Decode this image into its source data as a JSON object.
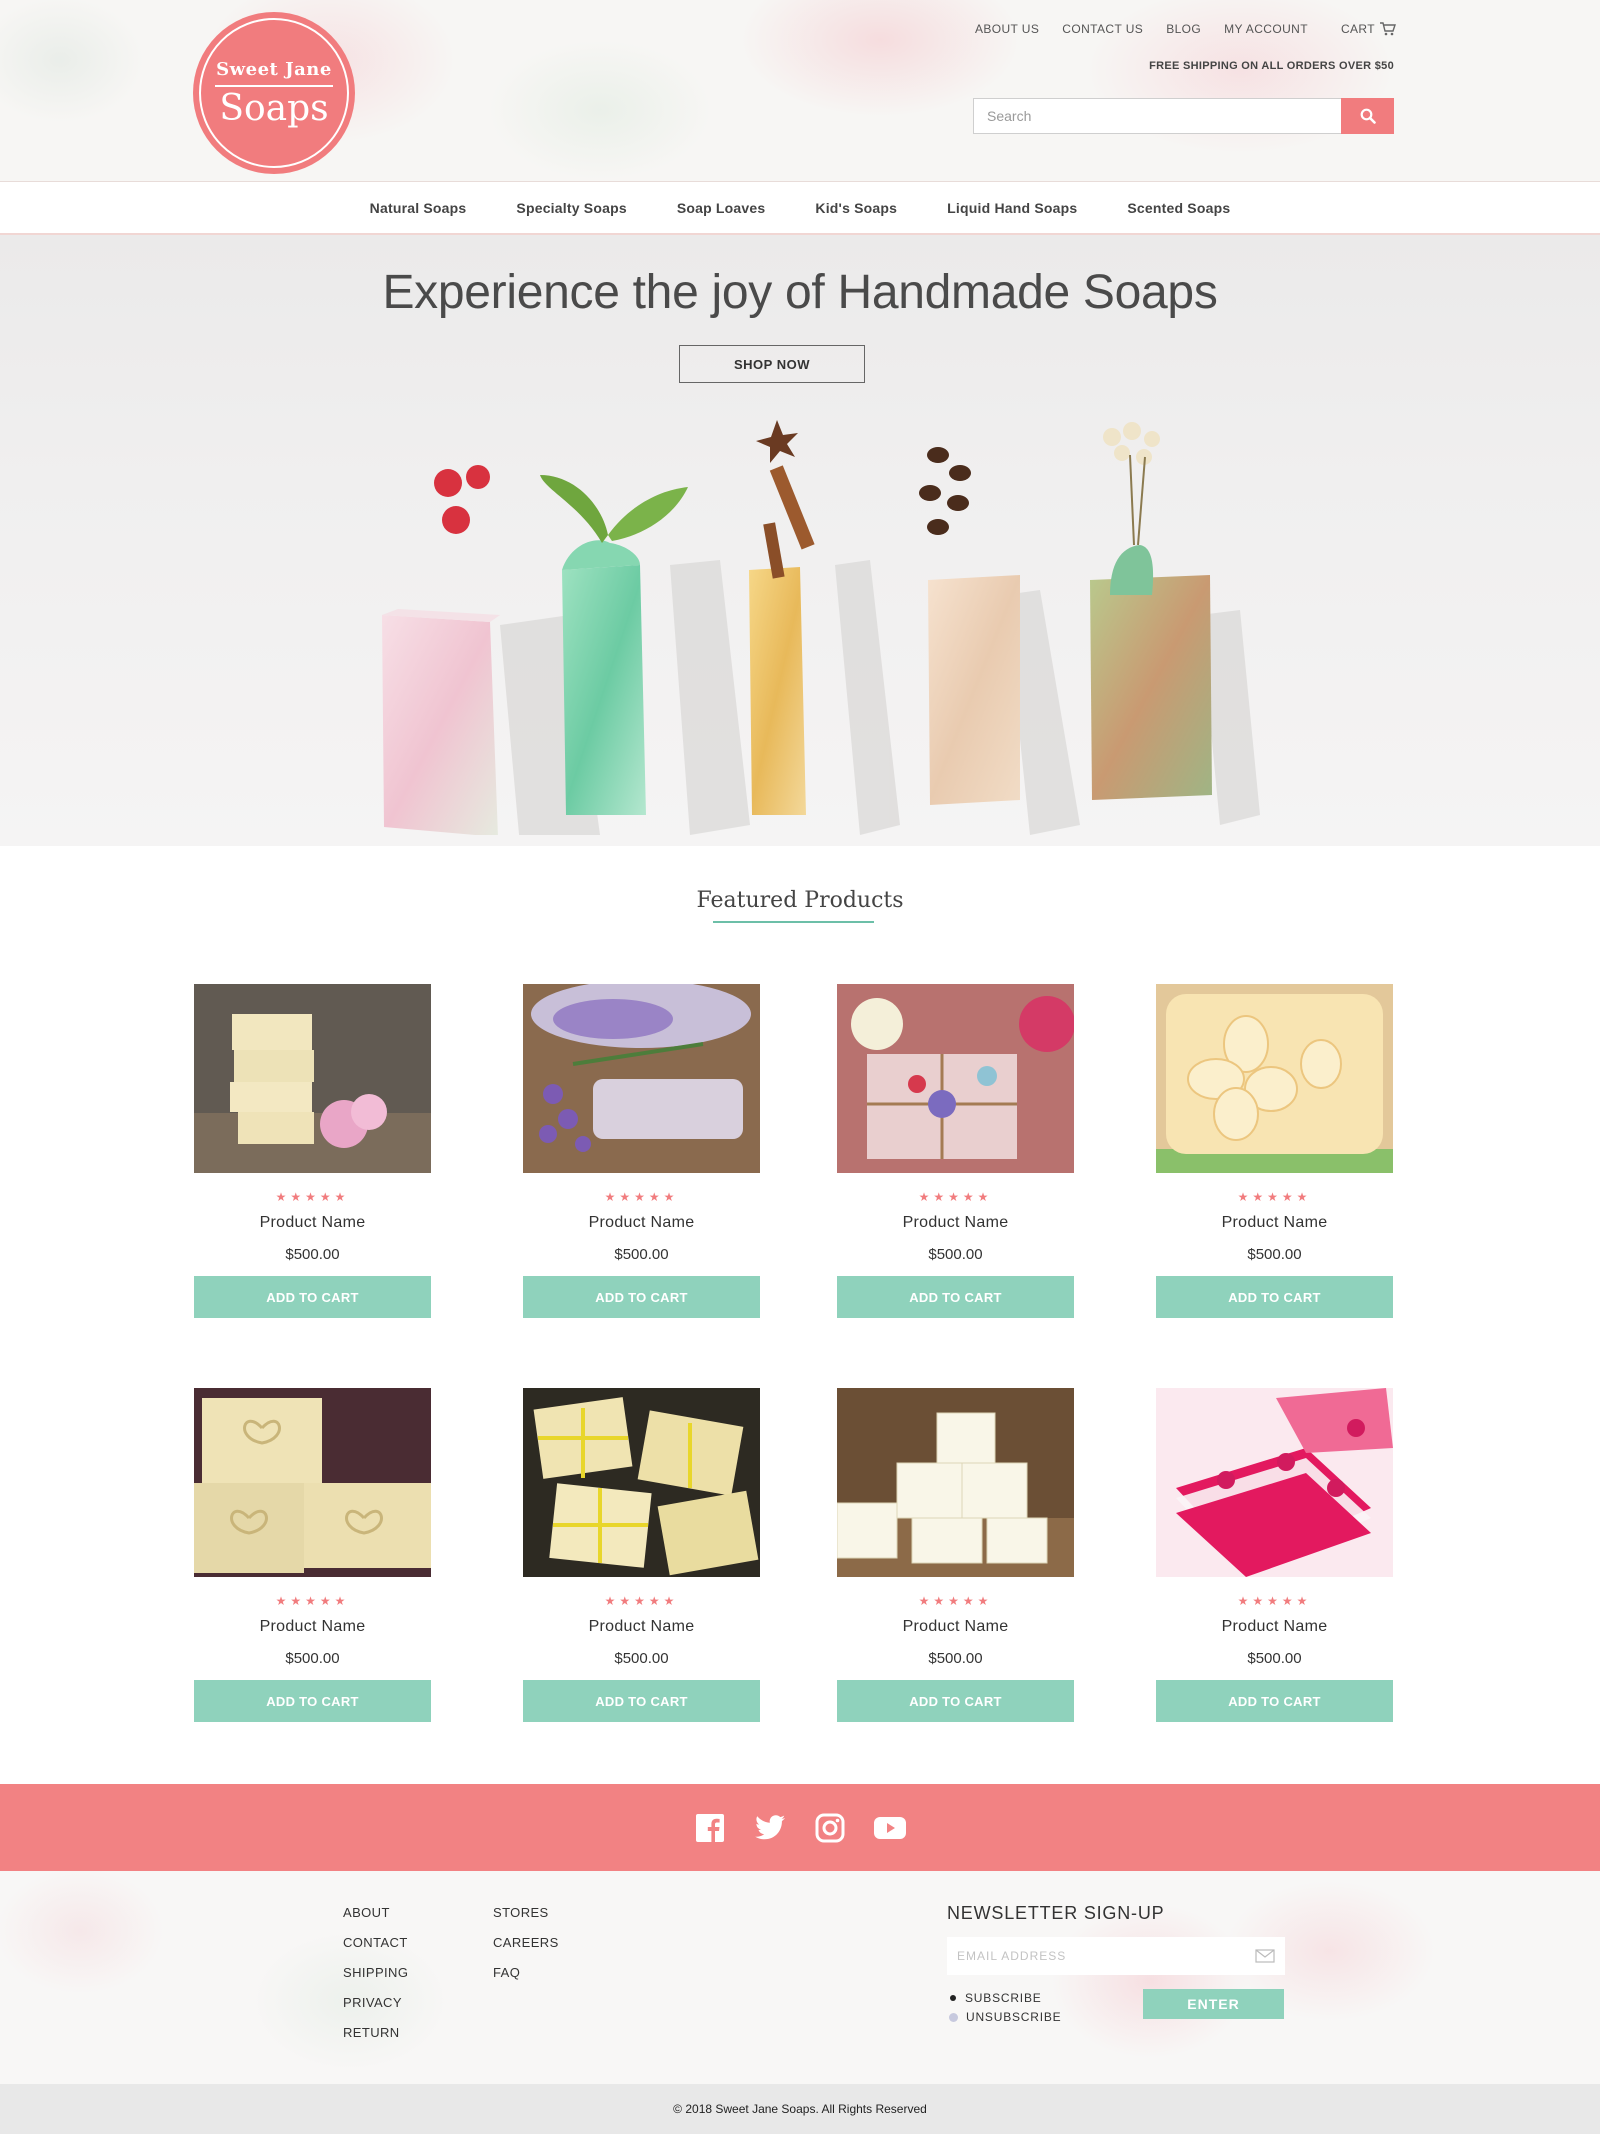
{
  "brand": {
    "logo_top": "Sweet Jane",
    "logo_main": "Soaps",
    "accent": "#f17c7e",
    "mint": "#8fd2bc"
  },
  "topnav": {
    "about": "ABOUT US",
    "contact": "CONTACT US",
    "blog": "BLOG",
    "account": "MY ACCOUNT",
    "cart": "CART"
  },
  "header": {
    "shipping": "FREE SHIPPING ON ALL ORDERS OVER $50"
  },
  "search": {
    "placeholder": "Search",
    "icon": "search-icon"
  },
  "categories": [
    "Natural Soaps",
    "Specialty Soaps",
    "Soap Loaves",
    "Kid's Soaps",
    "Liquid Hand Soaps",
    "Scented Soaps"
  ],
  "hero": {
    "title": "Experience the joy of Handmade Soaps",
    "button": "SHOP NOW"
  },
  "featured": {
    "title": "Featured Products"
  },
  "products": [
    {
      "stars": "★★★★★",
      "rating": 5,
      "name": "Product Name",
      "price": "$500.00",
      "button": "ADD TO CART"
    },
    {
      "stars": "★★★★★",
      "rating": 5,
      "name": "Product Name",
      "price": "$500.00",
      "button": "ADD TO CART"
    },
    {
      "stars": "★★★★★",
      "rating": 5,
      "name": "Product Name",
      "price": "$500.00",
      "button": "ADD TO CART"
    },
    {
      "stars": "★★★★★",
      "rating": 5,
      "name": "Product Name",
      "price": "$500.00",
      "button": "ADD TO CART"
    },
    {
      "stars": "★★★★★",
      "rating": 5,
      "name": "Product Name",
      "price": "$500.00",
      "button": "ADD TO CART"
    },
    {
      "stars": "★★★★★",
      "rating": 5,
      "name": "Product Name",
      "price": "$500.00",
      "button": "ADD TO CART"
    },
    {
      "stars": "★★★★★",
      "rating": 5,
      "name": "Product Name",
      "price": "$500.00",
      "button": "ADD TO CART"
    },
    {
      "stars": "★★★★★",
      "rating": 5,
      "name": "Product Name",
      "price": "$500.00",
      "button": "ADD TO CART"
    }
  ],
  "social": [
    "facebook-icon",
    "twitter-icon",
    "instagram-icon",
    "youtube-icon"
  ],
  "footer": {
    "col1": [
      "ABOUT",
      "CONTACT",
      "SHIPPING",
      "PRIVACY",
      "RETURN"
    ],
    "col2": [
      "STORES",
      "CAREERS",
      "FAQ"
    ],
    "newsletter_title": "NEWSLETTER SIGN-UP",
    "email_placeholder": "EMAIL ADDRESS",
    "subscribe": "SUBSCRIBE",
    "unsubscribe": "UNSUBSCRIBE",
    "enter": "ENTER",
    "copyright": "© 2018 Sweet Jane Soaps. All Rights Reserved"
  }
}
